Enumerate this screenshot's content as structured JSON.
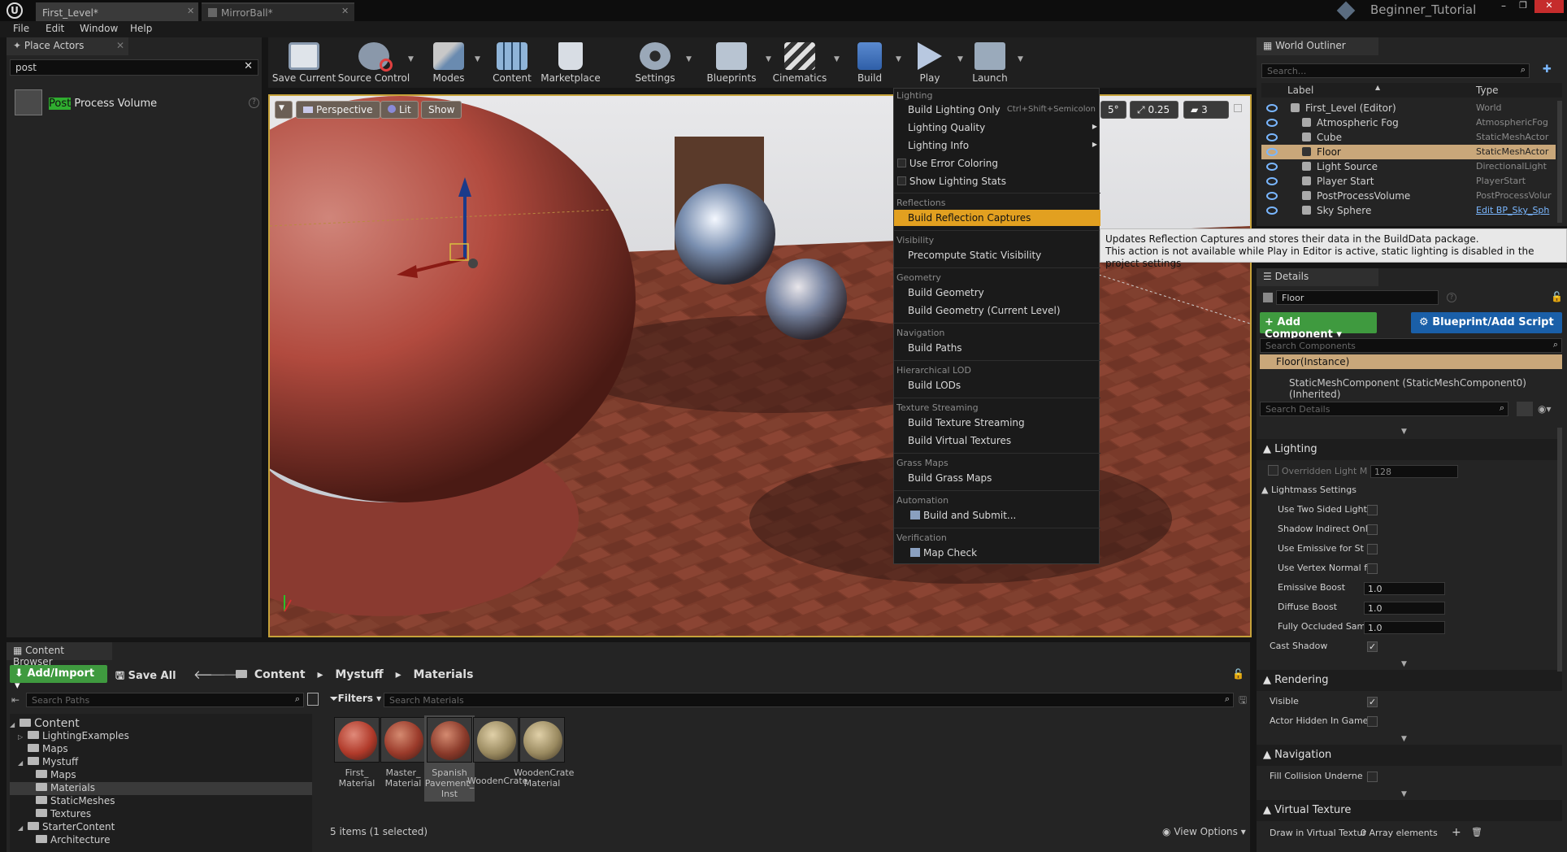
{
  "window": {
    "tabs": [
      "First_Level*",
      "MirrorBall*"
    ],
    "project": "Beginner_Tutorial"
  },
  "menu": [
    "File",
    "Edit",
    "Window",
    "Help"
  ],
  "place_actors": {
    "title": "Place Actors",
    "search_value": "post",
    "result_highlight": "Post",
    "result_rest": " Process Volume"
  },
  "toolbar": [
    {
      "label": "Save Current",
      "icon": "save-icon"
    },
    {
      "label": "Source Control",
      "icon": "source-control-icon"
    },
    {
      "label": "Modes",
      "icon": "modes-icon"
    },
    {
      "label": "Content",
      "icon": "content-icon"
    },
    {
      "label": "Marketplace",
      "icon": "marketplace-icon"
    },
    {
      "label": "Settings",
      "icon": "settings-icon"
    },
    {
      "label": "Blueprints",
      "icon": "blueprints-icon"
    },
    {
      "label": "Cinematics",
      "icon": "cinematics-icon"
    },
    {
      "label": "Build",
      "icon": "build-icon"
    },
    {
      "label": "Play",
      "icon": "play-icon"
    },
    {
      "label": "Launch",
      "icon": "launch-icon"
    }
  ],
  "viewport": {
    "perspective": "Perspective",
    "lit": "Lit",
    "show": "Show",
    "snap_angle": "5°",
    "snap_scale": "0.25",
    "camera_speed": "3"
  },
  "build_menu": {
    "lighting_header": "Lighting",
    "build_lighting_only": "Build Lighting Only",
    "build_lighting_shortcut": "Ctrl+Shift+Semicolon",
    "lighting_quality": "Lighting Quality",
    "lighting_info": "Lighting Info",
    "use_error_coloring": "Use Error Coloring",
    "show_lighting_stats": "Show Lighting Stats",
    "reflections_header": "Reflections",
    "build_reflection_captures": "Build Reflection Captures",
    "visibility_header": "Visibility",
    "precompute_static_visibility": "Precompute Static Visibility",
    "geometry_header": "Geometry",
    "build_geometry": "Build Geometry",
    "build_geometry_current": "Build Geometry (Current Level)",
    "navigation_header": "Navigation",
    "build_paths": "Build Paths",
    "hlod_header": "Hierarchical LOD",
    "build_lods": "Build LODs",
    "texture_streaming_header": "Texture Streaming",
    "build_texture_streaming": "Build Texture Streaming",
    "build_virtual_textures": "Build Virtual Textures",
    "grass_maps_header": "Grass Maps",
    "build_grass_maps": "Build Grass Maps",
    "automation_header": "Automation",
    "build_and_submit": "Build and Submit...",
    "verification_header": "Verification",
    "map_check": "Map Check"
  },
  "tooltip": {
    "line1": "Updates Reflection Captures and stores their data in the BuildData package.",
    "line2": "This action is not available while Play in Editor is active, static lighting is disabled in the project settings"
  },
  "outliner": {
    "title": "World Outliner",
    "search_placeholder": "Search...",
    "col_label": "Label",
    "col_type": "Type",
    "rows": [
      {
        "label": "First_Level (Editor)",
        "type": "World"
      },
      {
        "label": "Atmospheric Fog",
        "type": "AtmosphericFog"
      },
      {
        "label": "Cube",
        "type": "StaticMeshActor"
      },
      {
        "label": "Floor",
        "type": "StaticMeshActor"
      },
      {
        "label": "Light Source",
        "type": "DirectionalLight"
      },
      {
        "label": "Player Start",
        "type": "PlayerStart"
      },
      {
        "label": "PostProcessVolume",
        "type": "PostProcessVolur"
      },
      {
        "label": "Sky Sphere",
        "type": "Edit BP_Sky_Sph"
      }
    ]
  },
  "details": {
    "title": "Details",
    "name_value": "Floor",
    "add_component": "+ Add Component",
    "blueprint_add": "Blueprint/Add Script",
    "search_components_placeholder": "Search Components",
    "instance": "Floor(Instance)",
    "component": "StaticMeshComponent (StaticMeshComponent0) (Inherited)",
    "search_details_placeholder": "Search Details",
    "lighting": "Lighting",
    "overridden_light": "Overridden Light M",
    "overridden_value": "128",
    "lightmass_settings": "Lightmass Settings",
    "use_two_sided": "Use Two Sided Light",
    "shadow_indirect": "Shadow Indirect Onl",
    "use_emissive": "Use Emissive for St",
    "use_vertex_normal": "Use Vertex Normal f",
    "emissive_boost": "Emissive Boost",
    "emissive_value": "1.0",
    "diffuse_boost": "Diffuse Boost",
    "diffuse_value": "1.0",
    "fully_occluded": "Fully Occluded Sam",
    "fully_occluded_value": "1.0",
    "cast_shadow": "Cast Shadow",
    "rendering": "Rendering",
    "visible": "Visible",
    "actor_hidden": "Actor Hidden In Game",
    "navigation": "Navigation",
    "fill_collision": "Fill Collision Underne",
    "virtual_texture": "Virtual Texture",
    "draw_virtual": "Draw in Virtual Textur",
    "array_elements": "0 Array elements"
  },
  "content_browser": {
    "title": "Content Browser",
    "add_import": "Add/Import",
    "save_all": "Save All",
    "crumbs": [
      "Content",
      "Mystuff",
      "Materials"
    ],
    "search_paths_placeholder": "Search Paths",
    "filters": "Filters",
    "search_materials_placeholder": "Search Materials",
    "tree": [
      {
        "label": "Content",
        "depth": 0
      },
      {
        "label": "LightingExamples",
        "depth": 1
      },
      {
        "label": "Maps",
        "depth": 1
      },
      {
        "label": "Mystuff",
        "depth": 1
      },
      {
        "label": "Maps",
        "depth": 2
      },
      {
        "label": "Materials",
        "depth": 2
      },
      {
        "label": "StaticMeshes",
        "depth": 2
      },
      {
        "label": "Textures",
        "depth": 2
      },
      {
        "label": "StarterContent",
        "depth": 1
      },
      {
        "label": "Architecture",
        "depth": 2
      }
    ],
    "assets": [
      {
        "l1": "First_",
        "l2": "Material",
        "l3": ""
      },
      {
        "l1": "Master_",
        "l2": "Material",
        "l3": ""
      },
      {
        "l1": "Spanish",
        "l2": "Pavement_",
        "l3": "Inst"
      },
      {
        "l1": "WoodenCrate",
        "l2": "",
        "l3": ""
      },
      {
        "l1": "WoodenCrate",
        "l2": "Material",
        "l3": ""
      }
    ],
    "status": "5 items (1 selected)",
    "view_options": "View Options"
  },
  "colors": {
    "accent_orange": "#e2a020",
    "selection_tan": "#c9a77a",
    "green_button": "#3f9a3f",
    "blue_button": "#1a5fa8"
  }
}
